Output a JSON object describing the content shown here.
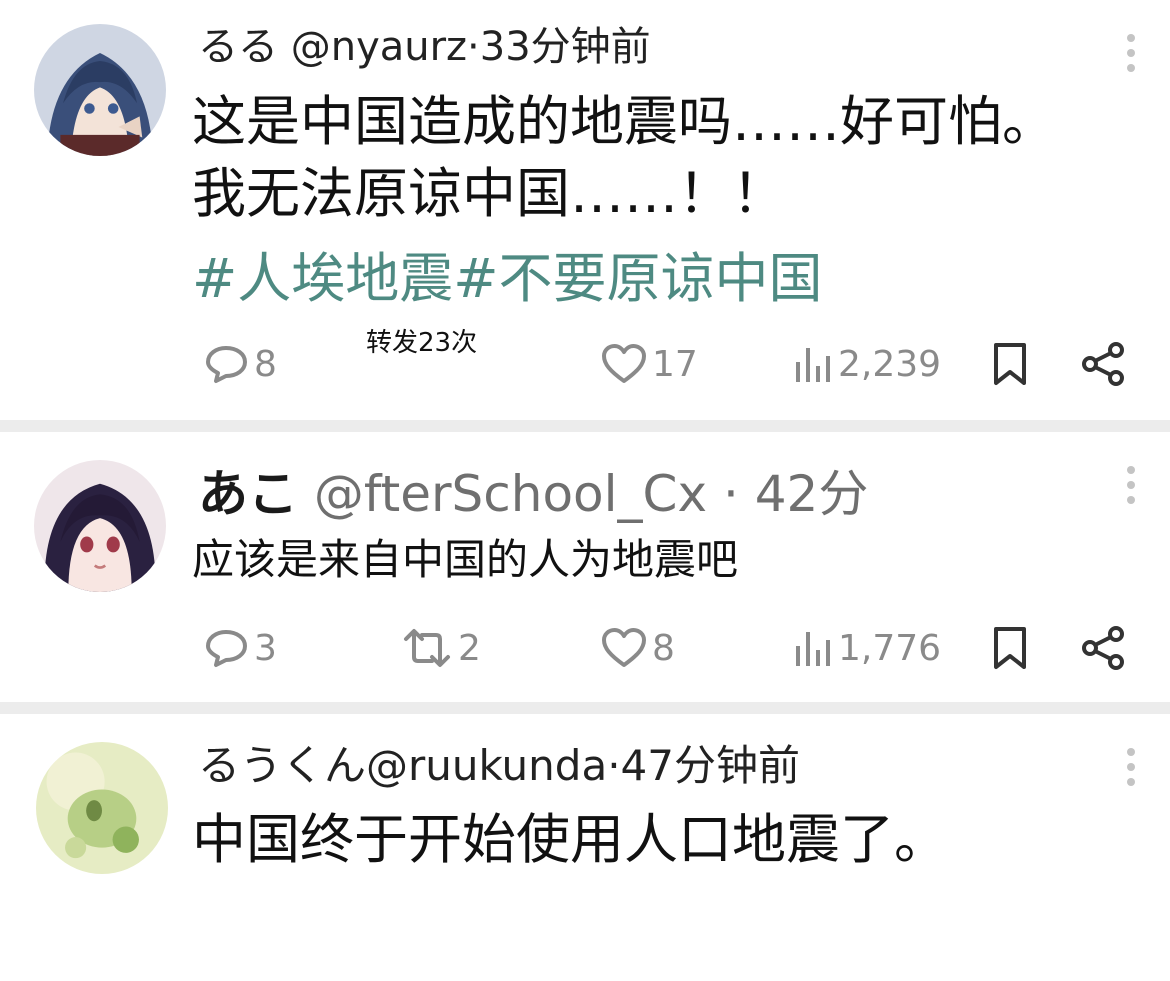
{
  "posts": [
    {
      "name": "るる",
      "handle": "@nyaurz·33分钟前",
      "body": "这是中国造成的地震吗……好可怕。我无法原谅中国……！！",
      "hashtags": "#人埃地震#不要原谅中国",
      "repost_note": "转发23次",
      "replies": "8",
      "likes": "17",
      "views": "2,239"
    },
    {
      "name": "あこ",
      "handle": "@fterSchool_Cx · 42分",
      "body": "应该是来自中国的人为地震吧",
      "replies": "3",
      "reposts": "2",
      "likes": "8",
      "views": "1,776"
    },
    {
      "name": "るうくん",
      "handle": "@ruukunda·47分钟前",
      "body": "中国终于开始使用人口地震了。"
    }
  ],
  "icons": {
    "reply": "speech-bubble-icon",
    "repost": "repost-arrows-icon",
    "like": "heart-icon",
    "views": "bar-chart-icon",
    "bookmark": "bookmark-icon",
    "share": "share-icon",
    "more": "vertical-dots-icon"
  },
  "colors": {
    "hashtag": "#4e8a82",
    "icon_gray": "#8a8a8a",
    "separator": "#ececec"
  }
}
